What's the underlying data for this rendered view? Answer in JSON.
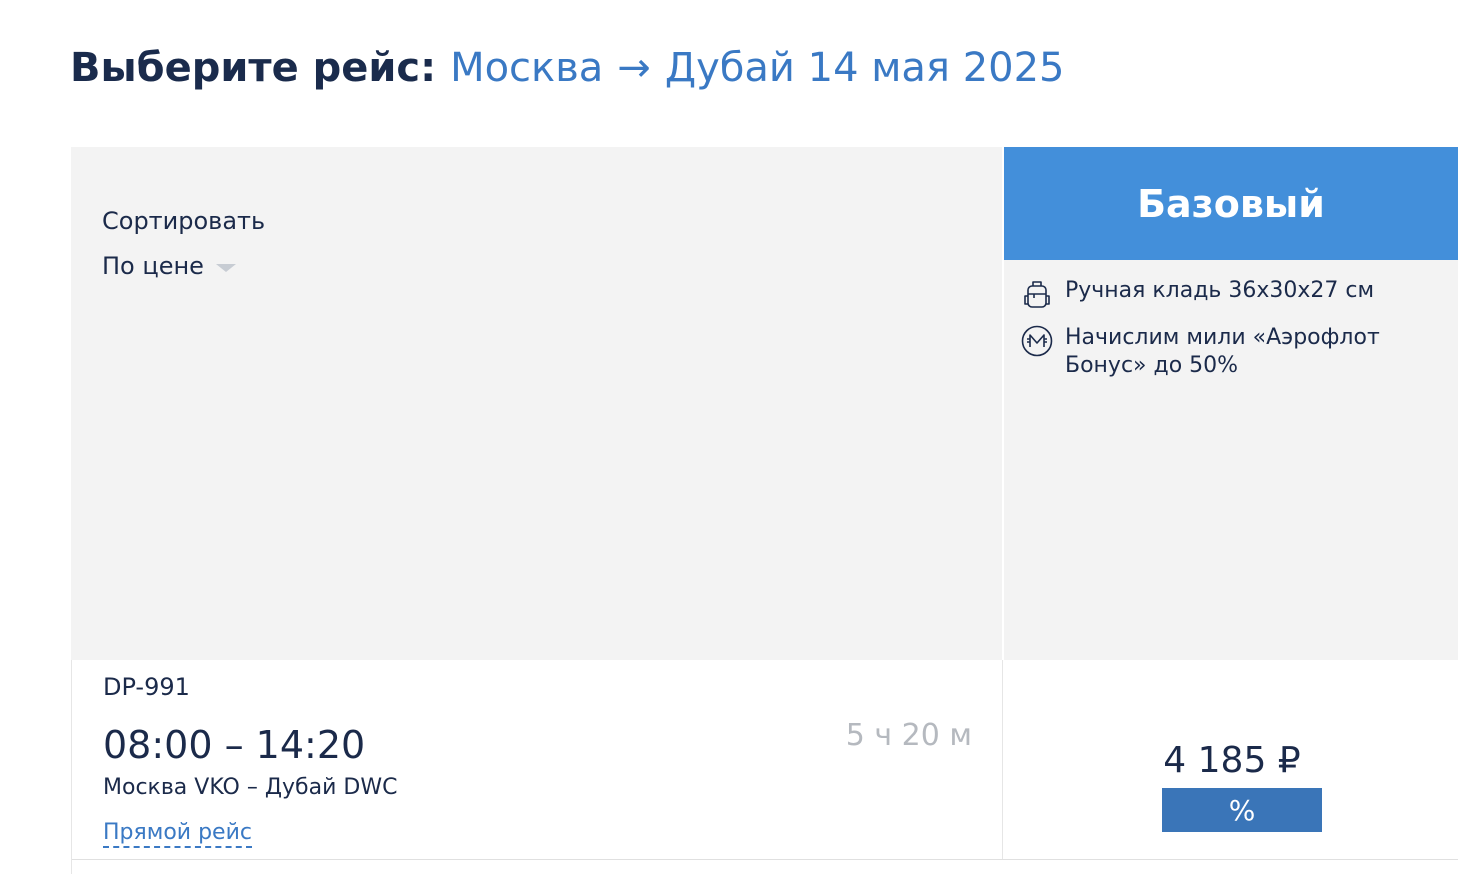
{
  "header": {
    "prefix": "Выберите рейс:",
    "origin": "Москва",
    "arrow": "→",
    "destination_date": "Дубай 14 мая 2025"
  },
  "sort": {
    "label": "Сортировать",
    "selected": "По цене"
  },
  "fare": {
    "name": "Базовый",
    "features": [
      {
        "icon": "backpack-icon",
        "text": "Ручная кладь 36х30х27 см"
      },
      {
        "icon": "miles-icon",
        "text": "Начислим мили «Аэрофлот Бонус» до 50%"
      }
    ]
  },
  "flights": [
    {
      "number": "DP-991",
      "times": "08:00 – 14:20",
      "duration": "5 ч 20 м",
      "route": "Москва VKO – Дубай DWC",
      "type": "Прямой рейс",
      "price": "4 185 ₽",
      "discount_label": "%"
    }
  ],
  "colors": {
    "accent": "#438fda",
    "link": "#3a79c4",
    "badge": "#3a75b8",
    "panel": "#f3f3f3",
    "text": "#1b2a4a"
  }
}
